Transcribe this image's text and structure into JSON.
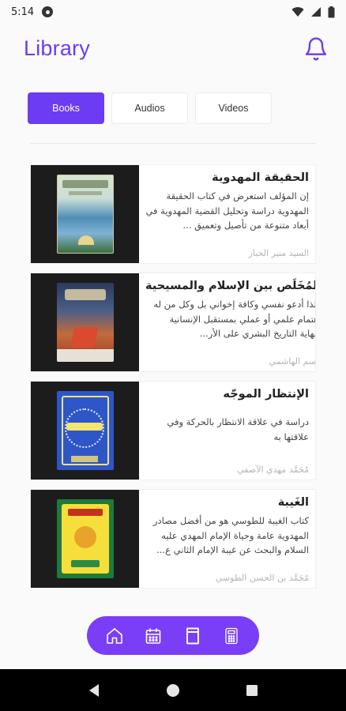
{
  "status": {
    "time": "5:14",
    "app_icon": "app-notification-icon",
    "wifi_icon": "wifi-icon",
    "signal_icon": "signal-icon",
    "battery_icon": "battery-icon"
  },
  "header": {
    "title": "Library",
    "bell_icon": "bell-icon"
  },
  "colors": {
    "accent": "#6c3cf4",
    "nav_background": "#7a3ef6"
  },
  "tabs": [
    {
      "label": "Books",
      "active": true
    },
    {
      "label": "Audios",
      "active": false
    },
    {
      "label": "Videos",
      "active": false
    }
  ],
  "books": [
    {
      "title": "الحقيقة المهدوية",
      "description": "إن المؤلف استعرض في كتاب الحقيقة المهدوية دراسة وتحليل القضية المهدوية في أبعاد متنوعة من تأصيل وتعميق ...",
      "author": "السيد منير الخباز"
    },
    {
      "title": "المُخَلِّص بين الإسلام والمسيحية",
      "description": "ولذا أدعو نفسي وكافة إخواني بل وكل من له اهتمام علمي أو عملي بمستقبل الإنسانية ونهاية التاريخ البشري على الأر...",
      "author": "باسم الهاشمي"
    },
    {
      "title": "الإنتظار الموجّه",
      "description": "دراسة في علاقة الانتظار بالحركة وفي علاقتها به",
      "author": "مُحَمَّد مهدي الآصفي"
    },
    {
      "title": "الغَيبة",
      "description": "كتاب الغيبة للطوسي هو من أفضل مصادر المهدوية عامة وحياة الإمام المهدي عليه السلام والبحث عن غيبة الإمام الثاني ع...",
      "author": "مُحَمَّد بن الحسن الطوسي"
    }
  ],
  "bottom_nav": [
    "home-icon",
    "calendar-icon",
    "book-icon",
    "calculator-icon"
  ],
  "system_nav": [
    "back-icon",
    "home-circle-icon",
    "recents-icon"
  ]
}
